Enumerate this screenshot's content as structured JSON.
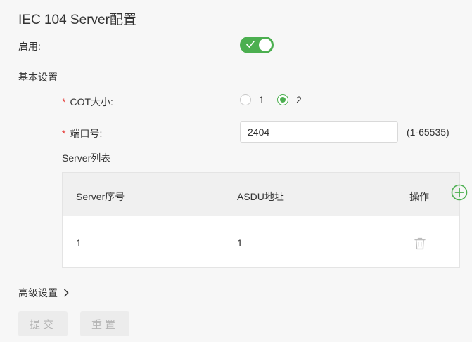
{
  "title": "IEC 104 Server配置",
  "enable": {
    "label": "启用:",
    "value": true
  },
  "basic_settings": {
    "heading": "基本设置",
    "cot": {
      "label": "COT大小:",
      "required_mark": "*",
      "options": [
        "1",
        "2"
      ],
      "selected": "2"
    },
    "port": {
      "label": "端口号:",
      "required_mark": "*",
      "value": "2404",
      "range_hint": "(1-65535)"
    }
  },
  "server_list": {
    "heading": "Server列表",
    "columns": [
      "Server序号",
      "ASDU地址",
      "操作"
    ],
    "rows": [
      {
        "index": "1",
        "asdu": "1"
      }
    ]
  },
  "advanced": {
    "label": "高级设置"
  },
  "buttons": {
    "submit": "提交",
    "reset": "重置"
  },
  "colors": {
    "accent": "#4caf50",
    "required": "#e53935",
    "disabled_text": "#b4b4b4"
  },
  "icons": {
    "toggle_check": "check-icon",
    "add": "plus-circle-icon",
    "delete": "trash-icon",
    "advanced": "chevron-right-icon"
  }
}
